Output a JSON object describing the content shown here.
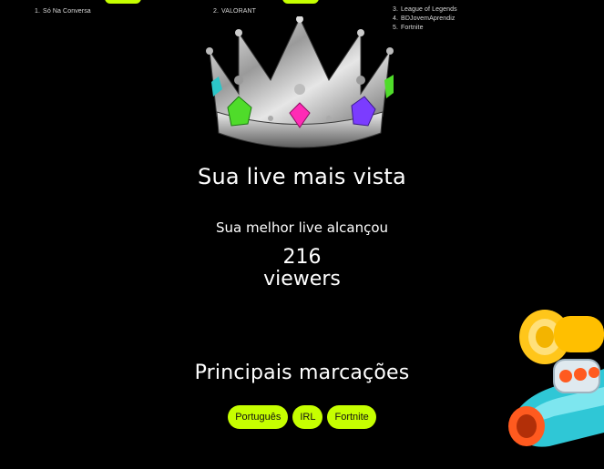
{
  "rank_left": {
    "items": [
      {
        "num": "1.",
        "label": "Só Na Conversa"
      }
    ]
  },
  "rank_mid": {
    "items": [
      {
        "num": "2.",
        "label": "VALORANT"
      }
    ]
  },
  "rank_right": {
    "items": [
      {
        "num": "3.",
        "label": "League of Legends"
      },
      {
        "num": "4.",
        "label": "BDJovemAprendiz"
      },
      {
        "num": "5.",
        "label": "Fortnite"
      }
    ]
  },
  "live": {
    "title": "Sua live mais vista",
    "subtitle": "Sua melhor live alcançou",
    "viewers_count": "216",
    "viewers_label": "viewers"
  },
  "tags": {
    "title": "Principais marcações",
    "items": [
      "Português",
      "IRL",
      "Fortnite"
    ]
  },
  "colors": {
    "accent": "#c6ff00",
    "background": "#000000"
  },
  "decor": {
    "crown": "crown-icon",
    "toy": "toy-blaster-icon"
  }
}
